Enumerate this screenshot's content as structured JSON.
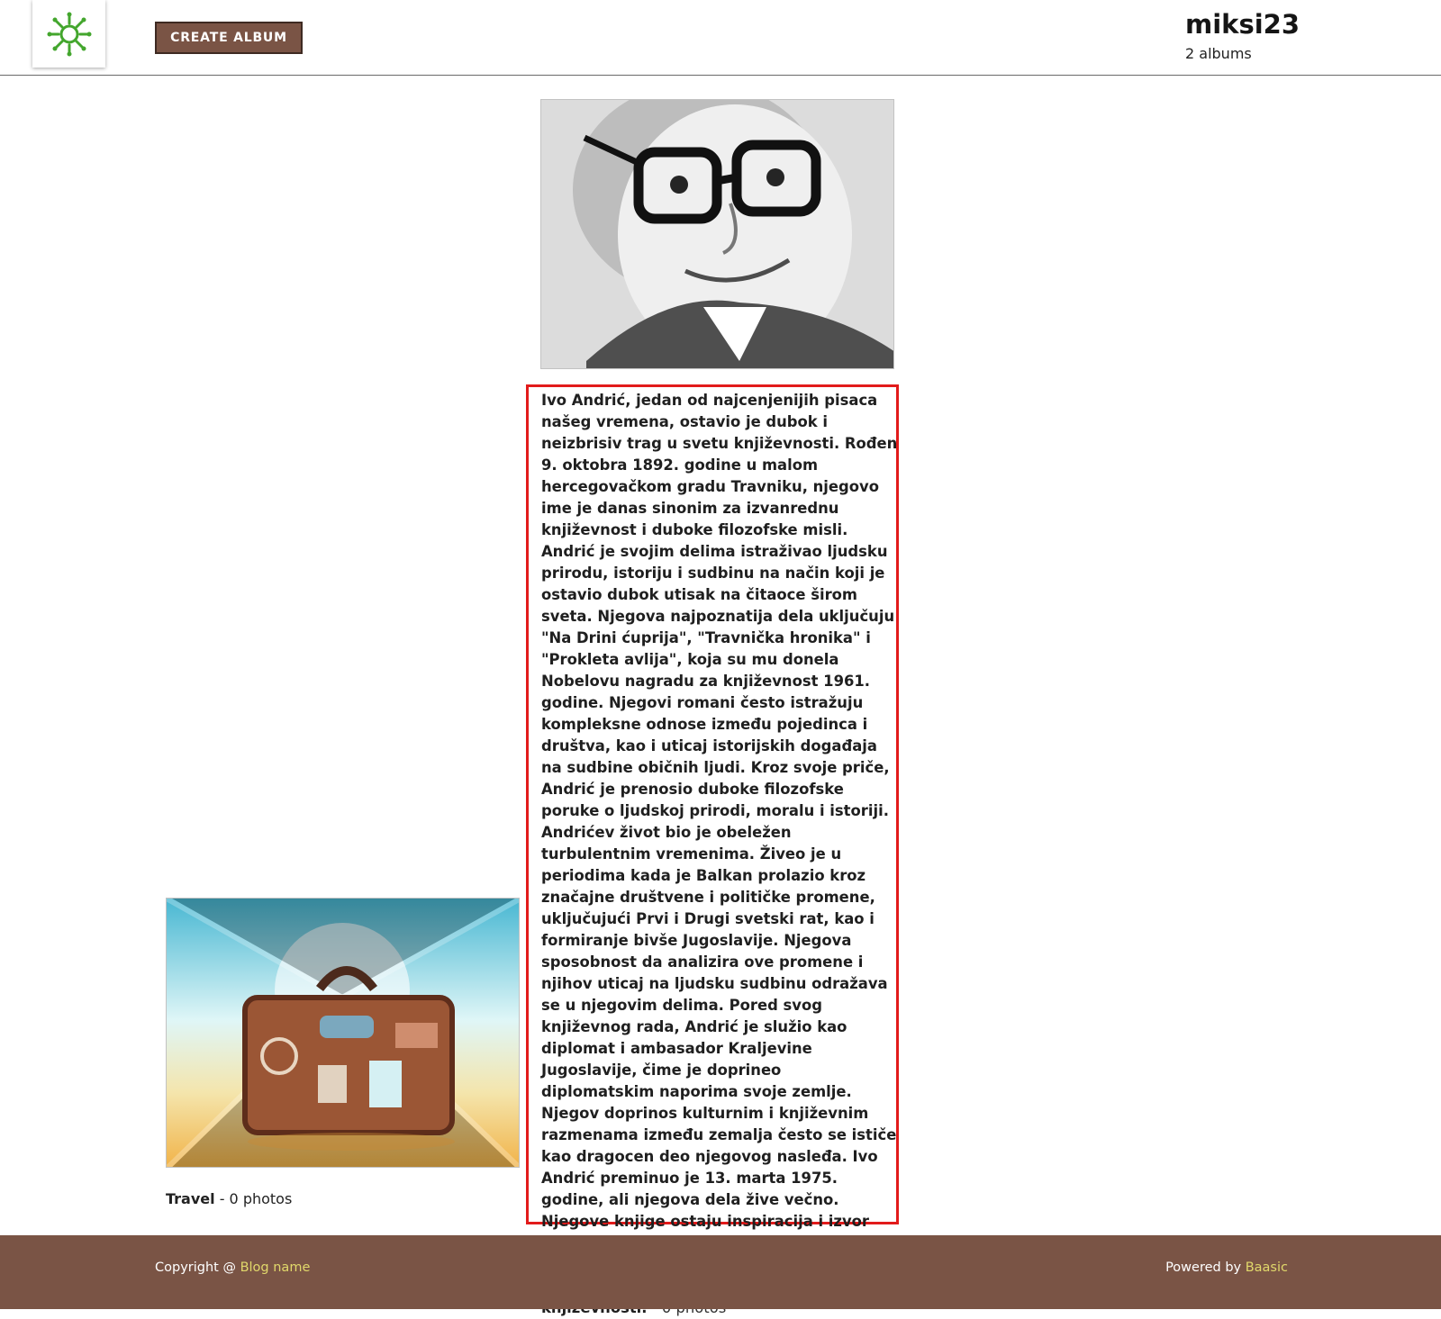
{
  "header": {
    "create_button": "CREATE ALBUM",
    "username": "miksi23",
    "album_count": "2 albums"
  },
  "albums": [
    {
      "image": "portrait-photo",
      "description": "Ivo Andrić, jedan od najcenjenijih pisaca našeg vremena, ostavio je dubok i neizbrisiv trag u svetu književnosti. Rođen 9. oktobra 1892. godine u malom hercegovačkom gradu Travniku, njegovo ime je danas sinonim za izvanrednu književnost i duboke filozofske misli. Andrić je svojim delima istraživao ljudsku prirodu, istoriju i sudbinu na način koji je ostavio dubok utisak na čitaoce širom sveta. Njegova najpoznatija dela uključuju \"Na Drini ćuprija\", \"Travnička hronika\" i \"Prokleta avlija\", koja su mu donela Nobelovu nagradu za književnost 1961. godine. Njegovi romani često istražuju kompleksne odnose između pojedinca i društva, kao i uticaj istorijskih događaja na sudbine običnih ljudi. Kroz svoje priče, Andrić je prenosio duboke filozofske poruke o ljudskoj prirodi, moralu i istoriji. Andrićev život bio je obeležen turbulentnim vremenima. Živeo je u periodima kada je Balkan prolazio kroz značajne društvene i političke promene, uključujući Prvi i Drugi svetski rat, kao i formiranje bivše Jugoslavije. Njegova sposobnost da analizira ove promene i njihov uticaj na ljudsku sudbinu odražava se u njegovim delima. Pored svog književnog rada, Andrić je služio kao diplomat i ambasador Kraljevine Jugoslavije, čime je doprineo diplomatskim naporima svoje zemlje. Njegov doprinos kulturnim i književnim razmenama između zemalja često se ističe kao dragocen deo njegovog nasleđa. Ivo Andrić preminuo je 13. marta 1975. godine, ali njegova dela žive večno. Njegove knjige ostaju inspiracija i izvor mudrosti za mnoge generacije čitalaca širom sveta, dok se njegovo ime pamti kao jedno od najvećih imena u svetu književnosti.",
      "count": " - 0 photos"
    },
    {
      "image": "suitcase-photo",
      "title": "Travel",
      "count": " - 0 photos"
    }
  ],
  "footer": {
    "copyright_prefix": "Copyright @ ",
    "blog_link": "Blog name",
    "powered_prefix": "Powered by ",
    "baasic_link": "Baasic"
  },
  "colors": {
    "brand_brown": "#7a5445",
    "footer_link": "#e1d86b",
    "selection_outline": "#e21b1b",
    "logo_green": "#43a62d"
  }
}
